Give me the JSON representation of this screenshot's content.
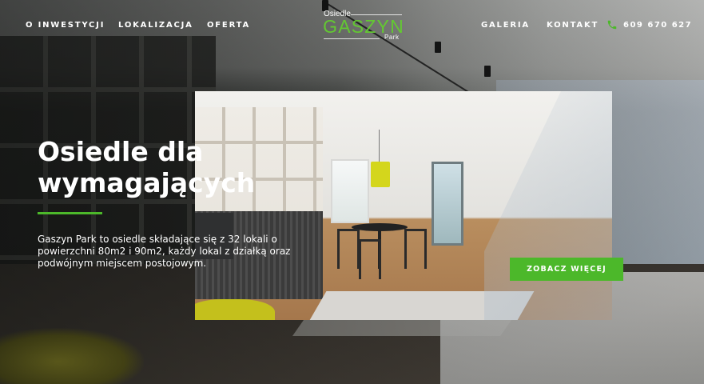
{
  "header": {
    "nav_left": [
      "O INWESTYCJI",
      "LOKALIZACJA",
      "OFERTA"
    ],
    "nav_right": [
      "GALERIA",
      "KONTAKT"
    ],
    "logo": {
      "top": "Osiedle",
      "main": "GASZYN",
      "bottom": "Park"
    },
    "phone": {
      "icon": "phone-icon",
      "number": "609 670 627"
    }
  },
  "hero": {
    "title_line1": "Osiedle dla",
    "title_line2": "wymagających",
    "description": "Gaszyn Park to osiedle składające się z 32 lokali o powierzchni 80m2 i 90m2, każdy lokal z działką oraz podwójnym miejscem postojowym.",
    "cta_label": "ZOBACZ WIĘCEJ"
  },
  "colors": {
    "accent": "#4cb82a",
    "logo_green": "#63c832",
    "text": "#ffffff"
  }
}
